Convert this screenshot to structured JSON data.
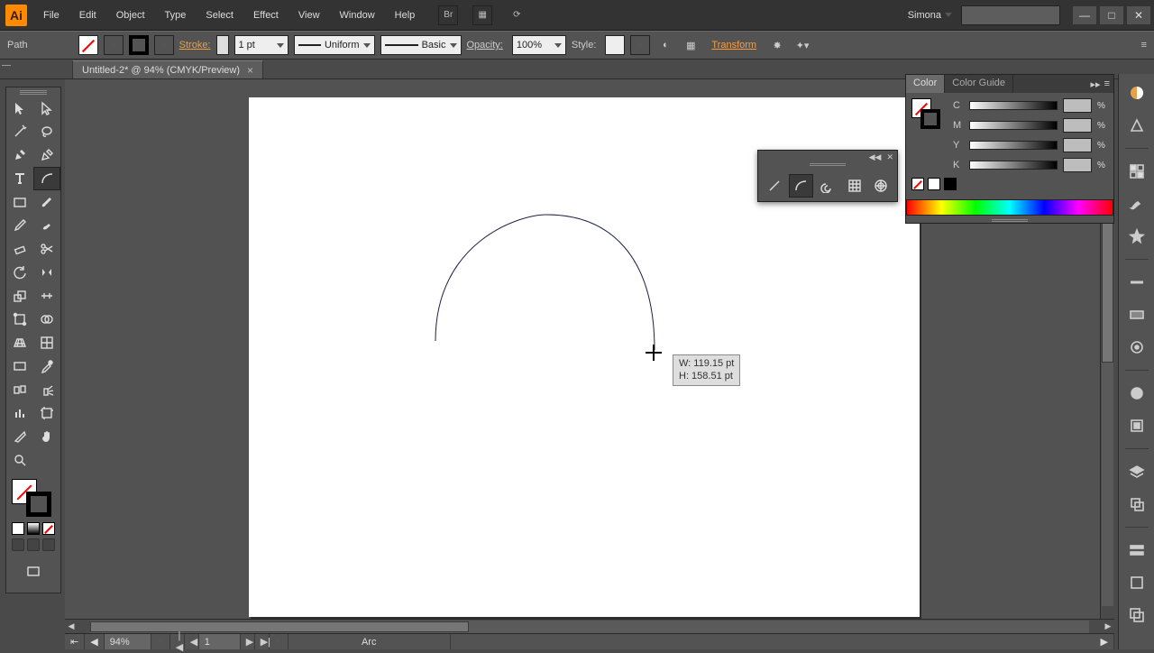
{
  "menu": {
    "items": [
      "File",
      "Edit",
      "Object",
      "Type",
      "Select",
      "Effect",
      "View",
      "Window",
      "Help"
    ],
    "user": "Simona"
  },
  "win": {
    "min": "—",
    "max": "□",
    "close": "✕"
  },
  "control": {
    "selection_label": "Path",
    "stroke_label": "Stroke:",
    "stroke_weight": "1 pt",
    "stroke_style": "Uniform",
    "brush_style": "Basic",
    "opacity_label": "Opacity:",
    "opacity_value": "100%",
    "style_label": "Style:",
    "transform_label": "Transform"
  },
  "tab": {
    "title": "Untitled-2* @ 94% (CMYK/Preview)"
  },
  "status": {
    "zoom": "94%",
    "artboard_num": "1",
    "tool": "Arc"
  },
  "measure": {
    "w": "W: 119.15 pt",
    "h": "H: 158.51 pt"
  },
  "panels": {
    "color_tab": "Color",
    "guide_tab": "Color Guide",
    "channels": [
      "C",
      "M",
      "Y",
      "K"
    ]
  }
}
